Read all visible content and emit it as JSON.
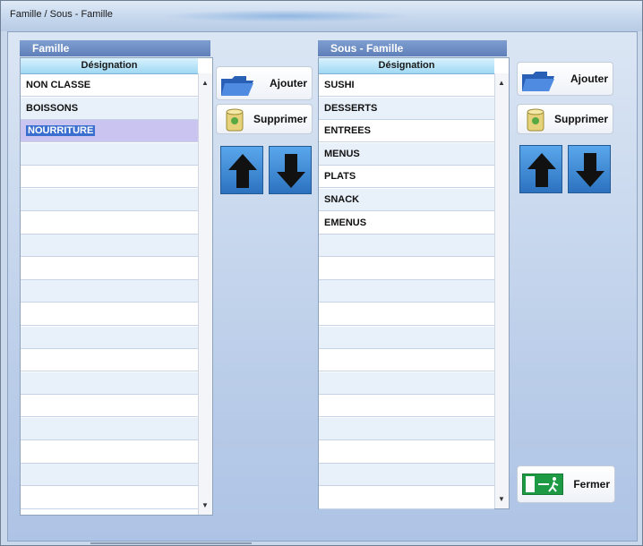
{
  "window": {
    "title": "Famille / Sous - Famille"
  },
  "famille": {
    "title": "Famille",
    "column_header": "Désignation",
    "items": [
      "NON CLASSE",
      "BOISSONS",
      "NOURRITURE"
    ],
    "selected": "NOURRITURE"
  },
  "sous_famille": {
    "title": "Sous - Famille",
    "column_header": "Désignation",
    "items": [
      "SUSHI",
      "DESSERTS",
      "ENTREES",
      "MENUS",
      "PLATS",
      "SNACK",
      "EMENUS"
    ]
  },
  "buttons": {
    "ajouter": "Ajouter",
    "supprimer": "Supprimer",
    "fermer": "Fermer"
  },
  "icons": {
    "folder": "open-folder-icon",
    "delete": "recycle-bin-icon",
    "up": "arrow-up-icon",
    "down": "arrow-down-icon",
    "exit": "exit-door-icon"
  }
}
